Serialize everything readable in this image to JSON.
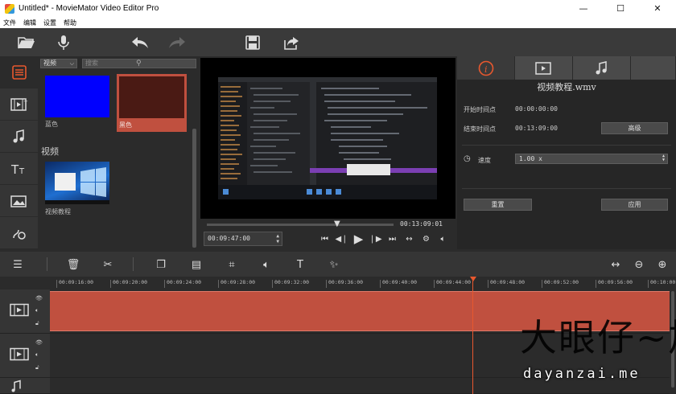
{
  "window": {
    "title": "Untitled* - MovieMator Video Editor Pro",
    "minimize": "—",
    "maximize": "☐",
    "close": "✕"
  },
  "menu": {
    "items": [
      "文件",
      "编辑",
      "设置",
      "帮助"
    ]
  },
  "toolbar": {
    "icons": [
      "folder-open-icon",
      "microphone-icon",
      "undo-icon",
      "redo-icon",
      "save-icon",
      "export-icon"
    ]
  },
  "sidenav": {
    "items": [
      "media-library-icon",
      "video-filter-icon",
      "audio-filter-icon",
      "text-icon",
      "image-filter-icon",
      "transition-icon"
    ]
  },
  "library": {
    "filter_value": "视频",
    "search_placeholder": "搜索",
    "colors": [
      {
        "label": "蓝色",
        "color": "#0000ff"
      },
      {
        "label": "黑色",
        "color": "#4a1a14"
      }
    ],
    "section_title": "视频",
    "videos": [
      {
        "label": "视频教程"
      }
    ]
  },
  "viewer": {
    "duration": "00:13:09:01",
    "current_time": "00:09:47:00",
    "progress": 0.73
  },
  "properties": {
    "clip_name": "视频教程.wmv",
    "start_label": "开始时间点",
    "start_value": "00:00:00:00",
    "end_label": "结束时间点",
    "end_value": "00:13:09:00",
    "advanced_button": "高级",
    "speed_label": "速度",
    "speed_value": "1.00 x",
    "reset_button": "重置",
    "apply_button": "应用"
  },
  "timeline": {
    "ruler_ticks": [
      "00:09:16:00",
      "00:09:20:00",
      "00:09:24:00",
      "00:09:28:00",
      "00:09:32:00",
      "00:09:36:00",
      "00:09:40:00",
      "00:09:44:00",
      "00:09:48:00",
      "00:09:52:00",
      "00:09:56:00",
      "00:10:00:"
    ]
  },
  "watermark": {
    "main": "大眼仔~旭",
    "sub": "dayanzai.me"
  },
  "accent": "#c0503f"
}
